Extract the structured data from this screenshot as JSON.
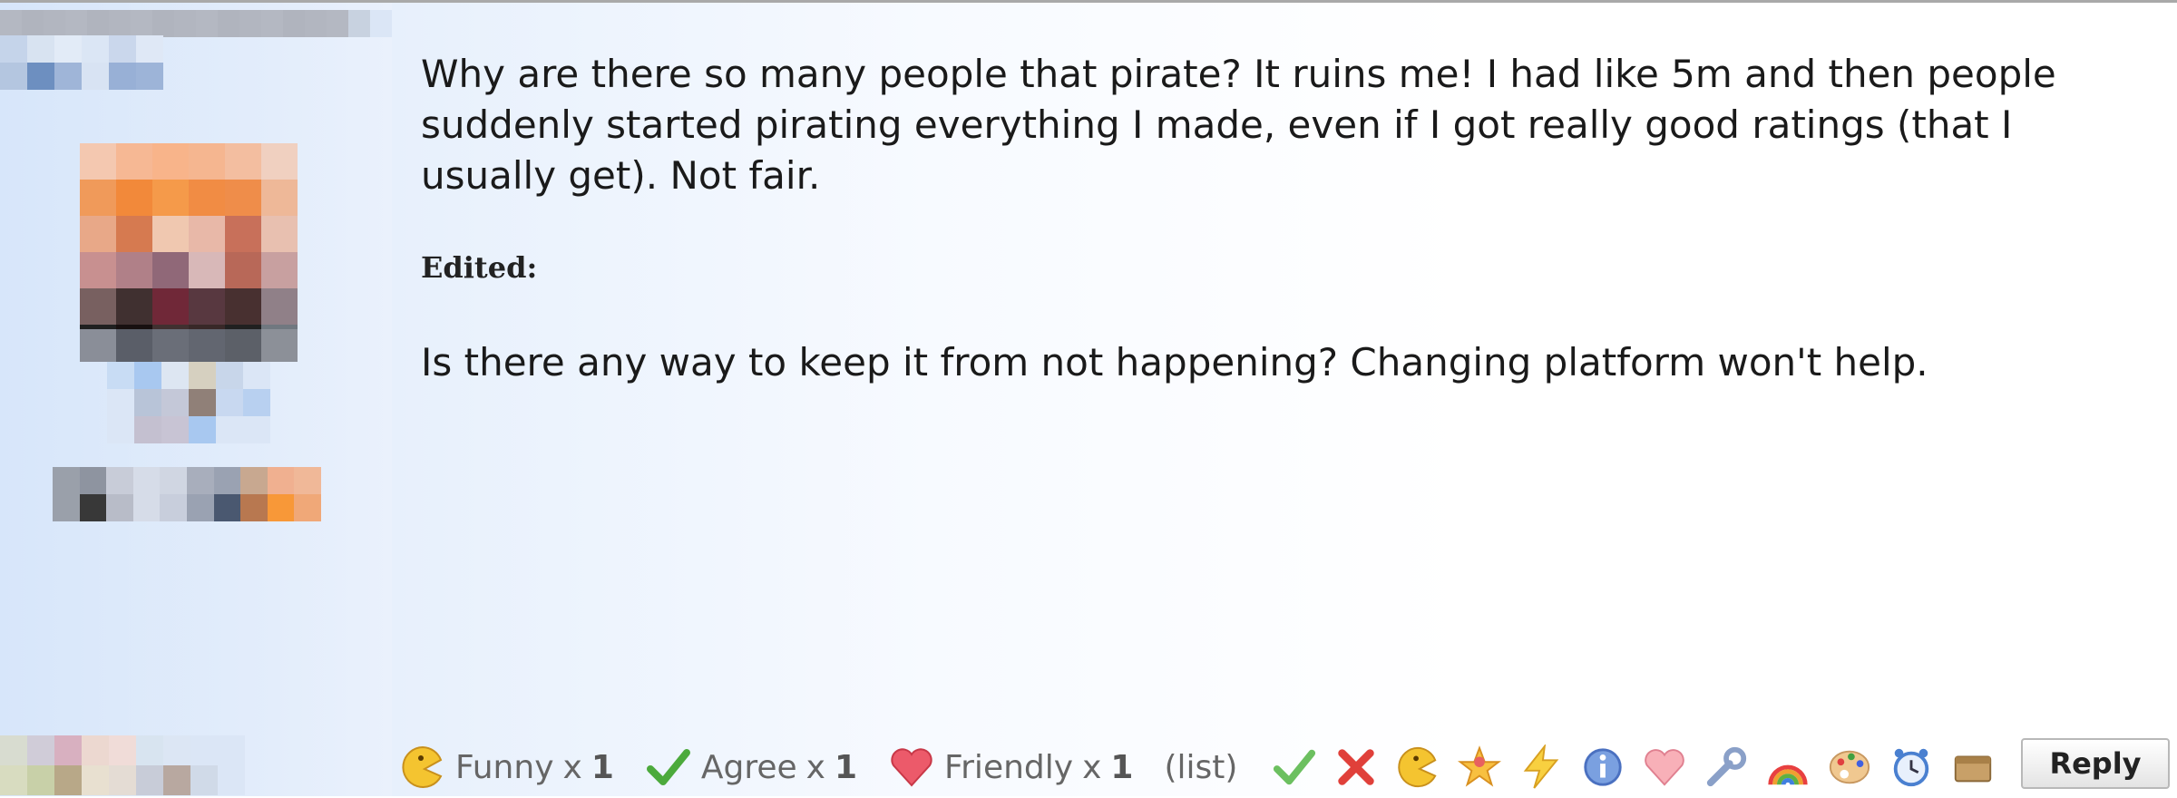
{
  "post": {
    "body": "Why are there so many people that pirate? It ruins me! I had like 5m and then people suddenly started pirating everything I made, even if I got really good ratings (that I usually get). Not fair.",
    "edited_label": "Edited:",
    "edit_body": "Is there any way to keep it from not happening? Changing platform won't help."
  },
  "ratings": {
    "items": [
      {
        "icon": "funny-icon",
        "label": "Funny",
        "mult": "x",
        "count": "1"
      },
      {
        "icon": "agree-icon",
        "label": "Agree",
        "mult": "x",
        "count": "1"
      },
      {
        "icon": "friendly-icon",
        "label": "Friendly",
        "mult": "x",
        "count": "1"
      }
    ],
    "list_label": "(list)"
  },
  "rate_buttons": [
    "agree-icon",
    "disagree-icon",
    "funny-icon",
    "winner-icon",
    "zing-icon",
    "informative-icon",
    "friendly-icon",
    "useful-icon",
    "optimistic-icon",
    "artistic-icon",
    "late-icon",
    "dumb-icon"
  ],
  "reply_label": "Reply",
  "colors": {
    "userinfo_bg": "#d7e6fa",
    "avatar_accent": "#f59a4a",
    "agree_green": "#4caa3c",
    "disagree_red": "#e0403a"
  }
}
